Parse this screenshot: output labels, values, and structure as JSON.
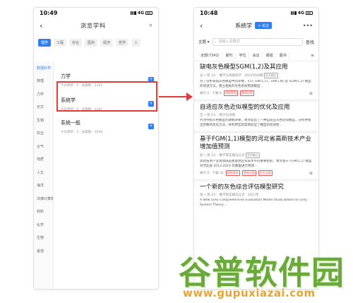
{
  "left": {
    "time": "10:49",
    "signal": "4G",
    "title": "浏览学科",
    "back_icon": "chevron-left-icon",
    "search_icon": "search-icon",
    "tabs": [
      "理学",
      "工程",
      "农业",
      "医药",
      "经济",
      "哲学",
      "人"
    ],
    "sidebar": [
      "数理科学",
      "物理",
      "力学",
      "天文",
      "生物",
      "农业",
      "大气",
      "地质",
      "人文",
      "海洋",
      "法律计算机",
      "材料",
      "化学",
      "生物",
      "其他"
    ],
    "subjects": [
      {
        "name": "力学",
        "meta": "今日更新：0 · 总篇数：1345"
      },
      {
        "name": "系统学",
        "meta": "今日更新：0 · 总篇数：5287"
      },
      {
        "name": "系统一般",
        "meta": "今日更新：0 · 总篇数：3638"
      }
    ],
    "add_label": "+"
  },
  "right": {
    "time": "10:48",
    "signal": "4G",
    "title": "系统学",
    "follow_label": "+ 关注",
    "more_icon": "more-icon",
    "search_scope": "主题 ▾",
    "search_placeholder": "请输入关键词",
    "search_button": "查找",
    "filters": [
      "全部(7341)",
      "期刊",
      "学位",
      "会议",
      "报纸",
      "图书"
    ],
    "articles": [
      {
        "title": "缺电灰色模型SGM(1,2)及其应用",
        "meta": "吴 • 等 3人 · 数学与系统科学 · 2021年06期",
        "tag": "北大核心",
        "abstract": "为了分析缺电灰色模型中的参数，引入 GM(1,1)、GM(1,N) 及 SGM(1,2) 模型的改进方法，建立相关的灰色系统预测模型…",
        "downloads": "被引 0 · 下载 8",
        "red_tags": [
          "网络首发",
          "增强出版"
        ]
      },
      {
        "title": "自适应灰色近似模型的优化及应用",
        "meta": "王 • 等 2人 · 统计与决策",
        "tag": "",
        "abstract": "针对传统灰色模型的建模效果，本文提出了一种自适应灰色近似模型，分析并给出参数的优化方法，并利用实际案例验证了模型的有效性…",
        "downloads": "",
        "red_tags": []
      },
      {
        "title": "基于FGM(1,1)模型的河北省高新技术产业增加值预测",
        "meta": "赵 • 等 3人 · 数学的实践与认识",
        "tag": "北大核心",
        "abstract": "高新技术产业增加值是衡量地区科技水平的重要指标，本文基于 FGM(1,1) 模型对河北省 2013-2019 年数据进行预测…",
        "downloads": "被引 0 · 下载 32",
        "red_tags": [
          "网络首发",
          "增强出版",
          "优先出版"
        ]
      },
      {
        "title": "一个新的灰色综合评估模型研究",
        "meta": "张 • 等 3人 · 数学的实践与认识 · 2021年",
        "tag": "",
        "abstract": "A New Grey Comprehensive Evaluation Model Study Based on Grey System Theory…",
        "downloads": "",
        "red_tags": []
      }
    ]
  },
  "watermark": {
    "main": "谷普软件园",
    "url": "www.gupuxiazai.com"
  },
  "colors": {
    "accent": "#2d7ff9",
    "highlight": "#e23b3b",
    "watermark_green": "#6aaa3a",
    "watermark_orange": "#e5a534"
  }
}
